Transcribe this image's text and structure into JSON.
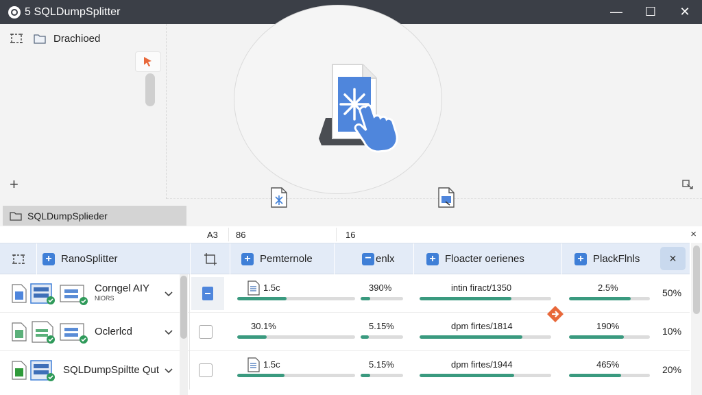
{
  "window": {
    "title": "5 SQLDumpSplitter",
    "minimize": "—",
    "maximize": "☐",
    "close": "✕"
  },
  "left_panel": {
    "label": "Drachioed",
    "add": "+"
  },
  "section": {
    "tab_label": "SQLDumpSplieder"
  },
  "grid": {
    "col_heads": [
      "A3",
      "86",
      "16"
    ],
    "col_close": "×",
    "headers": {
      "name": "RanoSplitter",
      "col1": "Pemternole",
      "col2": "enlx",
      "col3": "Floacter oerienes",
      "col4": "PlackFlnls",
      "close": "×"
    },
    "rows": [
      {
        "name": "Corngel AIY",
        "sub": "NIORS",
        "size": "1.5c",
        "size_fill": 0.42,
        "rate": "390%",
        "rate_fill": 0.22,
        "files": "intin firact/1350",
        "files_fill": 0.7,
        "ratio": "2.5%",
        "ratio_fill": 0.76,
        "progress": "50%",
        "selected": true
      },
      {
        "name": "Oclerlcd",
        "sub": "",
        "size": "30.1%",
        "size_fill": 0.25,
        "rate": "5.15%",
        "rate_fill": 0.2,
        "files": "dpm firtes/1814",
        "files_fill": 0.78,
        "ratio": "190%",
        "ratio_fill": 0.68,
        "progress": "10%",
        "selected": false
      },
      {
        "name": "SQLDumpSpiltte Qut",
        "sub": "",
        "size": "1.5c",
        "size_fill": 0.4,
        "rate": "5.15%",
        "rate_fill": 0.22,
        "files": "dpm firtes/1944",
        "files_fill": 0.72,
        "ratio": "465%",
        "ratio_fill": 0.64,
        "progress": "20%",
        "selected": false
      }
    ]
  },
  "colors": {
    "titlebar": "#3b3f47",
    "accent": "#3f7fd7",
    "progress": "#3a9a7f",
    "header_bg": "#e3ebf7",
    "warning": "#e8683a"
  }
}
